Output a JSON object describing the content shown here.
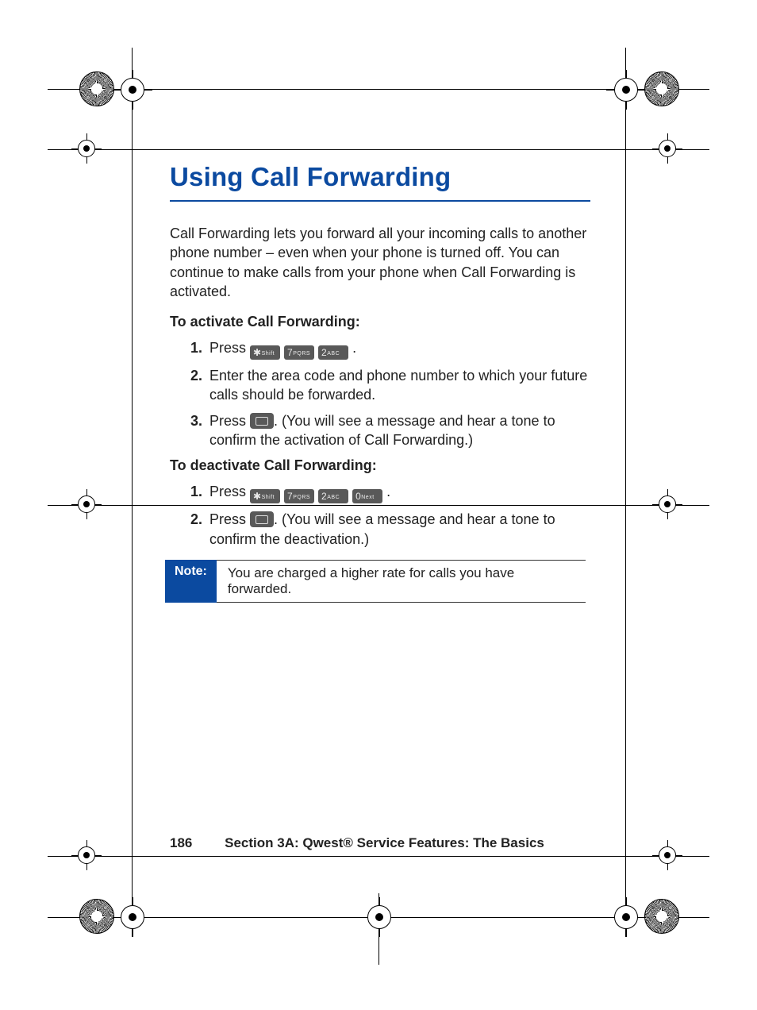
{
  "title": "Using Call Forwarding",
  "intro": "Call Forwarding lets you forward all your incoming calls to another phone number – even when your phone is turned off. You can continue to make calls from your phone when Call Forwarding is activated.",
  "activate": {
    "heading": "To activate Call Forwarding:",
    "steps": {
      "s1_a": "Press ",
      "s1_b": ".",
      "s2": "Enter the area code and phone number to which your future calls should be forwarded.",
      "s3_a": "Press ",
      "s3_b": ". (You will see a message and hear a tone to confirm the activation of Call Forwarding.)"
    }
  },
  "deactivate": {
    "heading": "To deactivate Call Forwarding:",
    "steps": {
      "s1_a": "Press ",
      "s1_b": ".",
      "s2_a": "Press ",
      "s2_b": ". (You will see a message and hear a tone to confirm the deactivation.)"
    }
  },
  "keys": {
    "star": "✱",
    "star_sub": "Shift",
    "seven": "7",
    "seven_sub": "PQRS",
    "two": "2",
    "two_sub": "ABC",
    "zero": "0",
    "zero_sub": "Next"
  },
  "note": {
    "label": "Note:",
    "text": "You are charged a higher rate for calls you have forwarded."
  },
  "footer": {
    "page": "186",
    "section": "Section 3A: Qwest® Service Features: The Basics"
  }
}
